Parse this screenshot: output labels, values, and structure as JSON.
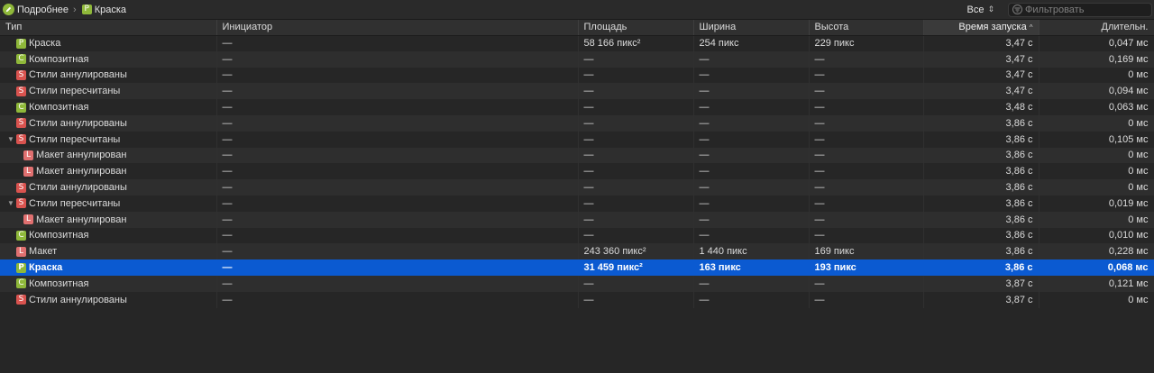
{
  "breadcrumb": [
    {
      "label": "Подробнее",
      "icon": "pencil-icon"
    },
    {
      "label": "Краска",
      "badge": "P"
    }
  ],
  "filter_dropdown": {
    "label": "Все"
  },
  "filter_input": {
    "placeholder": "Фильтровать"
  },
  "colors": {
    "paint": "#8fb83a",
    "composite": "#8fb83a",
    "styles": "#d9534f",
    "layout": "#e07070",
    "selection": "#0b5ad1"
  },
  "table": {
    "columns": [
      "Тип",
      "Инициатор",
      "Площадь",
      "Ширина",
      "Высота",
      "Время запуска",
      "Длительн."
    ],
    "sorted_column": "Время запуска",
    "rows": [
      {
        "badge": "P",
        "kind": "paint",
        "type": "Краска",
        "initiator": "—",
        "area": "58 166 пикс²",
        "width": "254 пикс",
        "height": "229 пикс",
        "start": "3,47 с",
        "duration": "0,047 мс"
      },
      {
        "badge": "C",
        "kind": "composite",
        "type": "Композитная",
        "initiator": "—",
        "area": "—",
        "width": "—",
        "height": "—",
        "start": "3,47 с",
        "duration": "0,169 мс"
      },
      {
        "badge": "S",
        "kind": "styles",
        "type": "Стили аннулированы",
        "initiator": "—",
        "area": "—",
        "width": "—",
        "height": "—",
        "start": "3,47 с",
        "duration": "0 мс"
      },
      {
        "badge": "S",
        "kind": "styles",
        "type": "Стили пересчитаны",
        "initiator": "—",
        "area": "—",
        "width": "—",
        "height": "—",
        "start": "3,47 с",
        "duration": "0,094 мс"
      },
      {
        "badge": "C",
        "kind": "composite",
        "type": "Композитная",
        "initiator": "—",
        "area": "—",
        "width": "—",
        "height": "—",
        "start": "3,48 с",
        "duration": "0,063 мс"
      },
      {
        "badge": "S",
        "kind": "styles",
        "type": "Стили аннулированы",
        "initiator": "—",
        "area": "—",
        "width": "—",
        "height": "—",
        "start": "3,86 с",
        "duration": "0 мс"
      },
      {
        "badge": "S",
        "kind": "styles",
        "type": "Стили пересчитаны",
        "expanded": true,
        "initiator": "—",
        "area": "—",
        "width": "—",
        "height": "—",
        "start": "3,86 с",
        "duration": "0,105 мс"
      },
      {
        "badge": "L",
        "kind": "layout",
        "child": true,
        "type": "Макет аннулирован",
        "initiator": "—",
        "area": "—",
        "width": "—",
        "height": "—",
        "start": "3,86 с",
        "duration": "0 мс"
      },
      {
        "badge": "L",
        "kind": "layout",
        "child": true,
        "type": "Макет аннулирован",
        "initiator": "—",
        "area": "—",
        "width": "—",
        "height": "—",
        "start": "3,86 с",
        "duration": "0 мс"
      },
      {
        "badge": "S",
        "kind": "styles",
        "type": "Стили аннулированы",
        "initiator": "—",
        "area": "—",
        "width": "—",
        "height": "—",
        "start": "3,86 с",
        "duration": "0 мс"
      },
      {
        "badge": "S",
        "kind": "styles",
        "type": "Стили пересчитаны",
        "expanded": true,
        "initiator": "—",
        "area": "—",
        "width": "—",
        "height": "—",
        "start": "3,86 с",
        "duration": "0,019 мс"
      },
      {
        "badge": "L",
        "kind": "layout",
        "child": true,
        "type": "Макет аннулирован",
        "initiator": "—",
        "area": "—",
        "width": "—",
        "height": "—",
        "start": "3,86 с",
        "duration": "0 мс"
      },
      {
        "badge": "C",
        "kind": "composite",
        "type": "Композитная",
        "initiator": "—",
        "area": "—",
        "width": "—",
        "height": "—",
        "start": "3,86 с",
        "duration": "0,010 мс"
      },
      {
        "badge": "L",
        "kind": "layout",
        "type": "Макет",
        "initiator": "—",
        "area": "243 360 пикс²",
        "width": "1 440 пикс",
        "height": "169 пикс",
        "start": "3,86 с",
        "duration": "0,228 мс"
      },
      {
        "badge": "P",
        "kind": "paint",
        "selected": true,
        "type": "Краска",
        "initiator": "—",
        "area": "31 459 пикс²",
        "width": "163 пикс",
        "height": "193 пикс",
        "start": "3,86 с",
        "duration": "0,068 мс"
      },
      {
        "badge": "C",
        "kind": "composite",
        "type": "Композитная",
        "initiator": "—",
        "area": "—",
        "width": "—",
        "height": "—",
        "start": "3,87 с",
        "duration": "0,121 мс"
      },
      {
        "badge": "S",
        "kind": "styles",
        "type": "Стили аннулированы",
        "initiator": "—",
        "area": "—",
        "width": "—",
        "height": "—",
        "start": "3,87 с",
        "duration": "0 мс"
      }
    ]
  }
}
